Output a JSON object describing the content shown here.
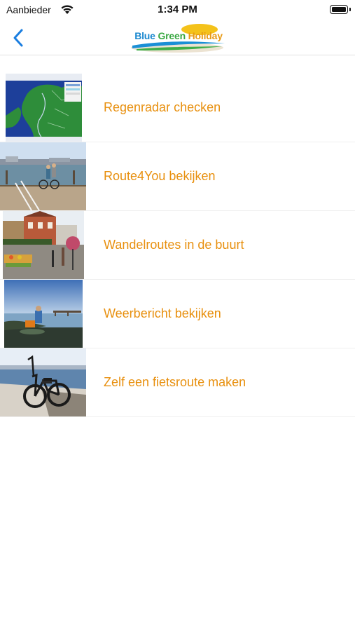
{
  "status_bar": {
    "carrier": "Aanbieder",
    "time": "1:34 PM"
  },
  "nav": {
    "back_icon": "chevron-left-icon",
    "logo_words": [
      "Blue",
      "Green",
      "Holiday"
    ]
  },
  "colors": {
    "accent": "#e8900f",
    "nav_tint": "#1a7ee0"
  },
  "items": [
    {
      "label": "Regenradar checken",
      "thumb": "rain-radar-map"
    },
    {
      "label": "Route4You bekijken",
      "thumb": "harbour-cyclists"
    },
    {
      "label": "Wandelroutes in de buurt",
      "thumb": "market-street"
    },
    {
      "label": "Weerbericht bekijken",
      "thumb": "coast-fisherman"
    },
    {
      "label": "Zelf een fietsroute maken",
      "thumb": "e-bike-beach"
    }
  ]
}
